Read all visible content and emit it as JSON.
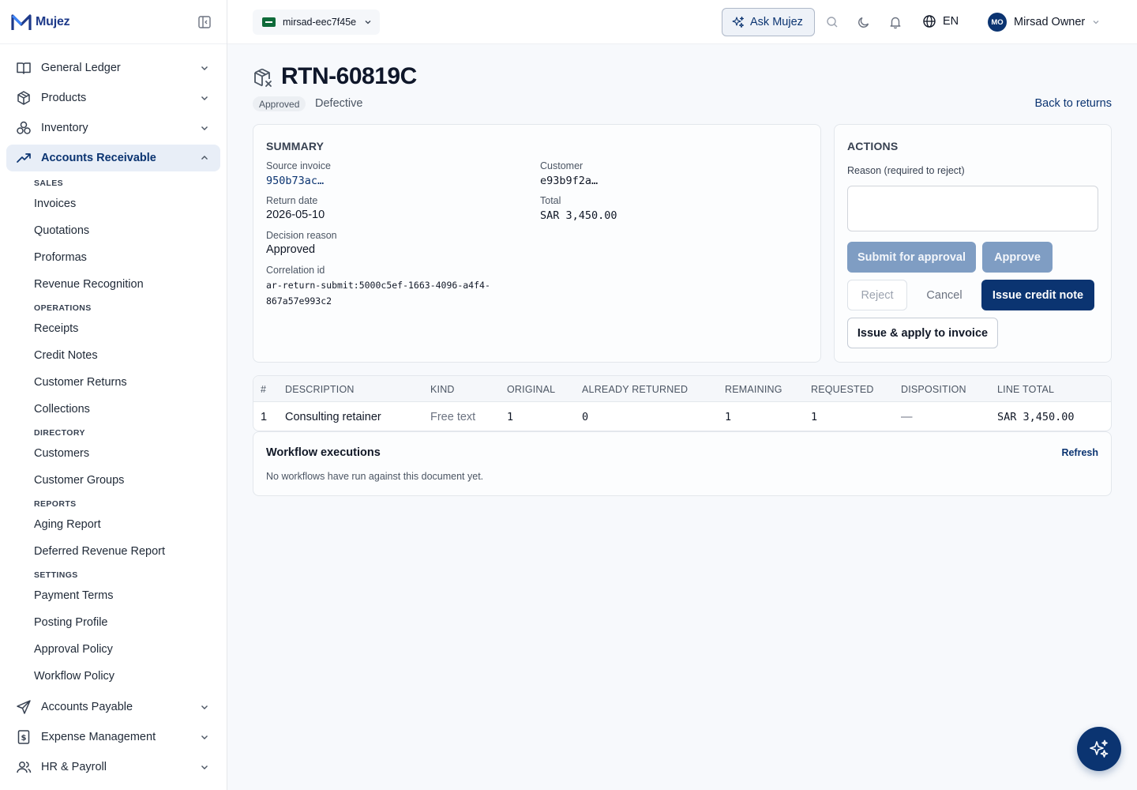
{
  "app": {
    "name": "Mujez"
  },
  "topbar": {
    "tenant": "mirsad-eec7f45e",
    "ask_label": "Ask Mujez",
    "language": "EN",
    "user_initials": "MO",
    "user_name": "Mirsad Owner"
  },
  "sidebar": {
    "top_items": [
      {
        "label": "General Ledger",
        "icon": "book-icon"
      },
      {
        "label": "Products",
        "icon": "box-icon"
      },
      {
        "label": "Inventory",
        "icon": "boxes-icon"
      },
      {
        "label": "Accounts Receivable",
        "icon": "trend-up-icon",
        "active": true
      }
    ],
    "groups": [
      {
        "heading": "SALES",
        "items": [
          "Invoices",
          "Quotations",
          "Proformas",
          "Revenue Recognition"
        ]
      },
      {
        "heading": "OPERATIONS",
        "items": [
          "Receipts",
          "Credit Notes",
          "Customer Returns",
          "Collections"
        ]
      },
      {
        "heading": "DIRECTORY",
        "items": [
          "Customers",
          "Customer Groups"
        ]
      },
      {
        "heading": "REPORTS",
        "items": [
          "Aging Report",
          "Deferred Revenue Report"
        ]
      },
      {
        "heading": "SETTINGS",
        "items": [
          "Payment Terms",
          "Posting Profile",
          "Approval Policy",
          "Workflow Policy"
        ]
      }
    ],
    "bottom_items": [
      {
        "label": "Accounts Payable",
        "icon": "send-icon"
      },
      {
        "label": "Expense Management",
        "icon": "receipt-icon"
      },
      {
        "label": "HR & Payroll",
        "icon": "users-icon"
      }
    ]
  },
  "page": {
    "title": "RTN-60819C",
    "status_badge": "Approved",
    "subtitle": "Defective",
    "back_link": "Back to returns"
  },
  "summary": {
    "title": "SUMMARY",
    "source_invoice_label": "Source invoice",
    "source_invoice_value": "950b73ac…",
    "customer_label": "Customer",
    "customer_value": "e93b9f2a…",
    "return_date_label": "Return date",
    "return_date_value": "2026-05-10",
    "total_label": "Total",
    "total_value": "SAR 3,450.00",
    "decision_reason_label": "Decision reason",
    "decision_reason_value": "Approved",
    "correlation_label": "Correlation id",
    "correlation_line1": "ar-return-submit:5000c5ef-1663-4096-a4f4-",
    "correlation_line2": "867a57e993c2"
  },
  "actions": {
    "title": "ACTIONS",
    "reason_label": "Reason (required to reject)",
    "reason_value": "",
    "submit_label": "Submit for approval",
    "approve_label": "Approve",
    "reject_label": "Reject",
    "cancel_label": "Cancel",
    "issue_credit_label": "Issue credit note",
    "issue_apply_label": "Issue & apply to invoice"
  },
  "lines": {
    "headers": [
      "#",
      "DESCRIPTION",
      "KIND",
      "ORIGINAL",
      "ALREADY RETURNED",
      "REMAINING",
      "REQUESTED",
      "DISPOSITION",
      "LINE TOTAL"
    ],
    "rows": [
      [
        "1",
        "Consulting retainer",
        "Free text",
        "1",
        "0",
        "1",
        "1",
        "—",
        "SAR 3,450.00"
      ]
    ]
  },
  "workflow": {
    "title": "Workflow executions",
    "refresh_label": "Refresh",
    "empty_text": "No workflows have run against this document yet."
  },
  "colors": {
    "primary": "#0b3471",
    "disabled": "#7f9dc3",
    "active_nav_bg": "#e8eef7"
  }
}
